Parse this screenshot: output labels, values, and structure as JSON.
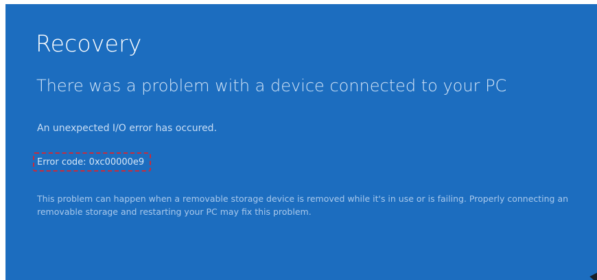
{
  "screen": {
    "title": "Recovery",
    "subtitle": "There was a problem with a device connected to your PC",
    "error_description": "An unexpected I/O error has occured.",
    "error_code": "Error code: 0xc00000e9",
    "help_text_line1": "This problem can happen when a removable storage device is removed while it's in use or is failing. Properly connecting an",
    "help_text_line2": "removable storage and restarting your PC may fix this problem."
  },
  "colors": {
    "background": "#1c6dbf",
    "highlight_border": "#c92b3a",
    "text": "#ffffff"
  }
}
